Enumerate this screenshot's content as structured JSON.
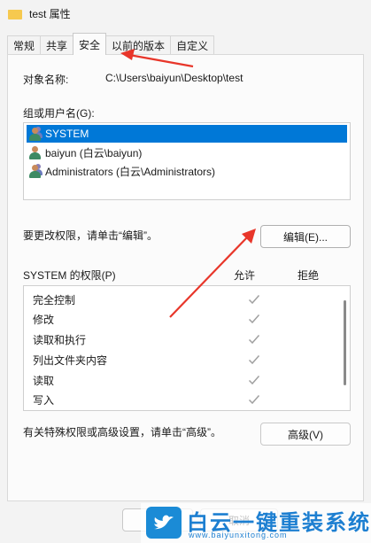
{
  "window": {
    "title": "test 属性"
  },
  "tabs": [
    {
      "label": "常规",
      "active": false
    },
    {
      "label": "共享",
      "active": false
    },
    {
      "label": "安全",
      "active": true
    },
    {
      "label": "以前的版本",
      "active": false
    },
    {
      "label": "自定义",
      "active": false
    }
  ],
  "security": {
    "object_label": "对象名称:",
    "object_value": "C:\\Users\\baiyun\\Desktop\\test",
    "groups_label": "组或用户名(G):",
    "users": [
      {
        "name": "SYSTEM",
        "selected": true,
        "icon": "group-icon"
      },
      {
        "name": "baiyun (白云\\baiyun)",
        "selected": false,
        "icon": "user-icon"
      },
      {
        "name": "Administrators (白云\\Administrators)",
        "selected": false,
        "icon": "group-icon"
      }
    ],
    "edit_hint": "要更改权限，请单击“编辑”。",
    "edit_button": "编辑(E)...",
    "perm_header": "SYSTEM 的权限(P)",
    "allow_header": "允许",
    "deny_header": "拒绝",
    "permissions": [
      {
        "name": "完全控制",
        "allow": true,
        "deny": false
      },
      {
        "name": "修改",
        "allow": true,
        "deny": false
      },
      {
        "name": "读取和执行",
        "allow": true,
        "deny": false
      },
      {
        "name": "列出文件夹内容",
        "allow": true,
        "deny": false
      },
      {
        "name": "读取",
        "allow": true,
        "deny": false
      },
      {
        "name": "写入",
        "allow": true,
        "deny": false
      }
    ],
    "advanced_hint": "有关特殊权限或高级设置，请单击“高级”。",
    "advanced_button": "高级(V)"
  },
  "footer": {
    "cancel_button": "取消"
  },
  "watermark": {
    "title": "白云一键重装系统",
    "url": "www.baiyunxitong.com"
  },
  "colors": {
    "selection": "#0078d7",
    "annotation_arrow": "#e8362a",
    "check": "#a0a0a0"
  }
}
